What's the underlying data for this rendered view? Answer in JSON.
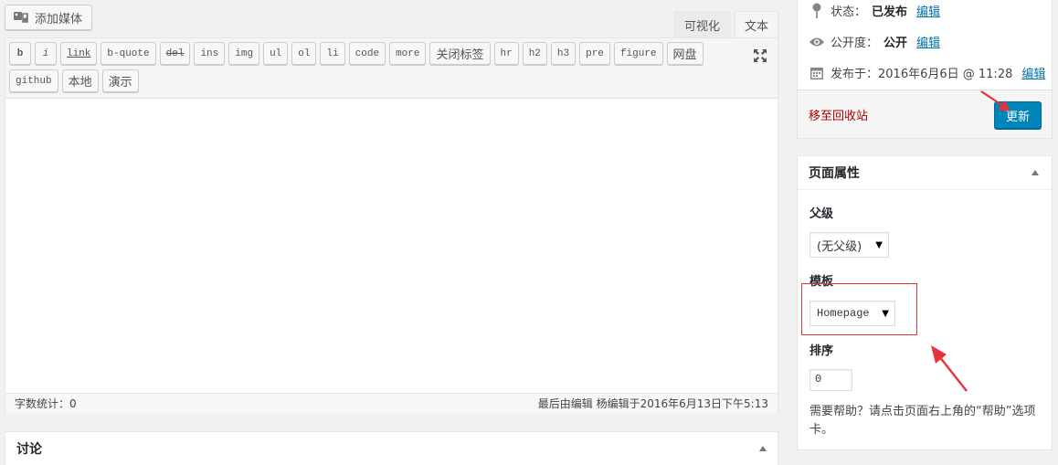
{
  "editor": {
    "add_media_label": "添加媒体",
    "tabs": [
      {
        "label": "可视化",
        "active": false
      },
      {
        "label": "文本",
        "active": true
      }
    ],
    "toolbar_row1": [
      "b",
      "i",
      "link",
      "b-quote",
      "del",
      "ins",
      "img",
      "ul",
      "ol",
      "li",
      "code",
      "more",
      "关闭标签",
      "hr",
      "h2",
      "h3",
      "pre",
      "figure",
      "网盘"
    ],
    "toolbar_row2": [
      "github",
      "本地",
      "演示"
    ],
    "word_count": "字数统计：0",
    "last_edited": "最后由编辑 杨编辑于2016年6月13日下午5:13"
  },
  "discussion": {
    "title": "讨论"
  },
  "publish": {
    "status_label": "状态：",
    "status_value": "已发布",
    "visibility_label": "公开度：",
    "visibility_value": "公开",
    "published_label": "发布于：2016年6月6日 @ 11:28",
    "edit_label": "编辑",
    "trash_label": "移至回收站",
    "update_label": "更新"
  },
  "page_attributes": {
    "title": "页面属性",
    "parent_label": "父级",
    "parent_value": "(无父级)",
    "template_label": "模板",
    "template_value": "Homepage",
    "order_label": "排序",
    "order_value": "0",
    "help_text": "需要帮助？请点击页面右上角的“帮助”选项卡。"
  },
  "colors": {
    "primary_button": "#0085ba",
    "link": "#0073aa",
    "trash": "#a00000",
    "annotation": "#e8313a"
  },
  "icons": [
    "media-icon",
    "fullscreen-icon",
    "pin-icon",
    "eye-icon",
    "calendar-icon",
    "collapse-arrow-icon"
  ]
}
